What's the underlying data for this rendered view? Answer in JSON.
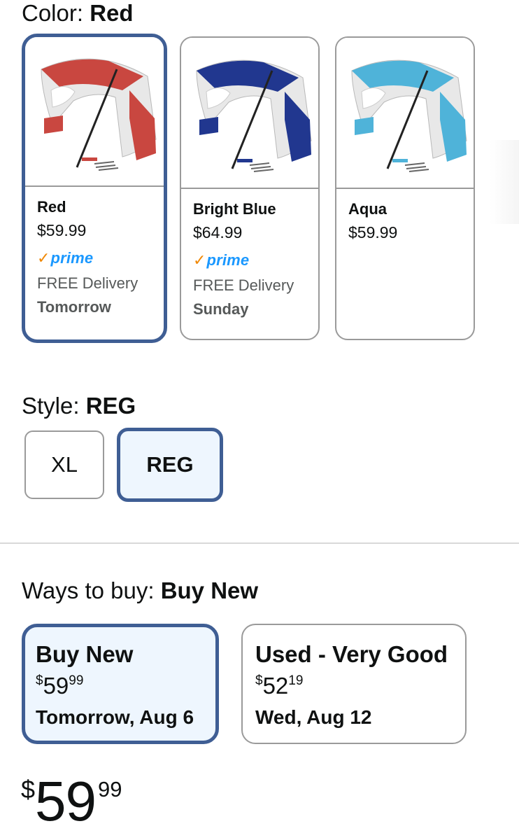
{
  "color_selector": {
    "label": "Color:",
    "selected_value": "Red",
    "options": [
      {
        "name": "Red",
        "price": "$59.99",
        "prime": true,
        "delivery": "FREE Delivery",
        "delivery_day": "Tomorrow",
        "canopy_color": "#c94740",
        "selected": true
      },
      {
        "name": "Bright Blue",
        "price": "$64.99",
        "prime": true,
        "delivery": "FREE Delivery",
        "delivery_day": "Sunday",
        "canopy_color": "#21378f",
        "selected": false
      },
      {
        "name": "Aqua",
        "price": "$59.99",
        "prime": false,
        "delivery": "",
        "delivery_day": "",
        "canopy_color": "#4fb3d9",
        "selected": false
      }
    ],
    "prime_check": "✓",
    "prime_word": "prime"
  },
  "style_selector": {
    "label": "Style:",
    "selected_value": "REG",
    "options": [
      {
        "label": "XL",
        "selected": false
      },
      {
        "label": "REG",
        "selected": true
      }
    ]
  },
  "ways_to_buy": {
    "label": "Ways to buy:",
    "selected_value": "Buy New",
    "options": [
      {
        "title": "Buy New",
        "currency": "$",
        "whole": "59",
        "fraction": "99",
        "delivery": "Tomorrow, Aug 6",
        "selected": true
      },
      {
        "title": "Used - Very Good",
        "currency": "$",
        "whole": "52",
        "fraction": "19",
        "delivery": "Wed, Aug 12",
        "selected": false
      }
    ]
  },
  "price": {
    "currency": "$",
    "whole": "59",
    "fraction": "99"
  },
  "colors": {
    "accent_border": "#3f5e94",
    "selected_bg": "#eef6fe",
    "prime_check": "#f08804",
    "prime_word": "#1a98ff"
  }
}
